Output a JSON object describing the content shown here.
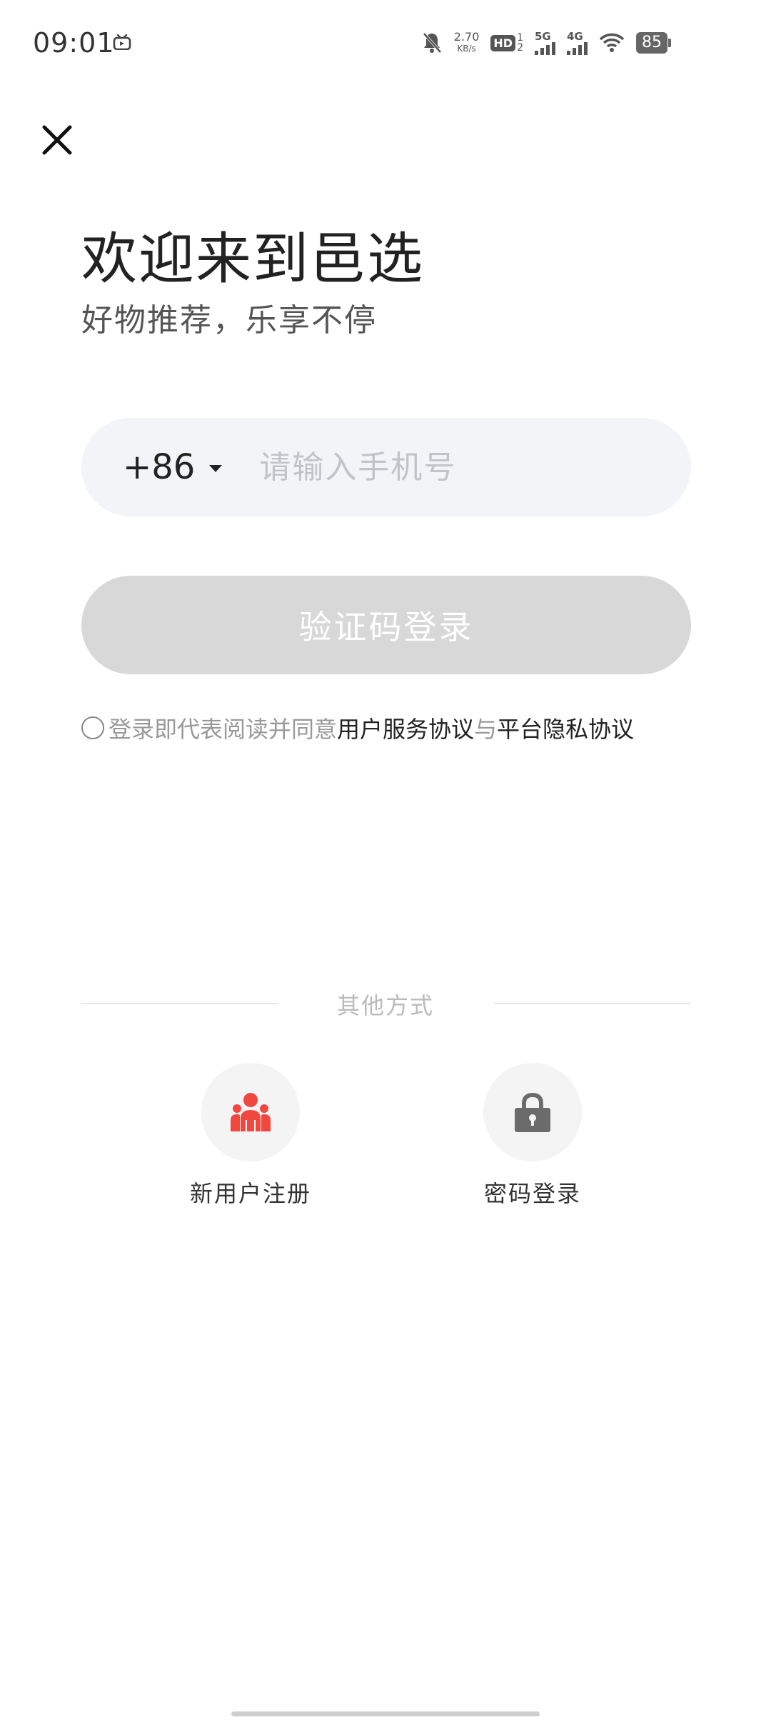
{
  "status_bar": {
    "time": "09:01",
    "net_speed_value": "2.70",
    "net_speed_unit": "KB/s",
    "hd_label": "HD",
    "sim1": "1",
    "sim2": "2",
    "signal1_label": "5G",
    "signal2_label": "4G",
    "battery": "85"
  },
  "header": {
    "title": "欢迎来到邑选",
    "subtitle": "好物推荐，乐享不停"
  },
  "phone": {
    "country_code": "+86",
    "placeholder": "请输入手机号",
    "value": ""
  },
  "login_button": {
    "label": "验证码登录"
  },
  "agreement": {
    "prefix": "登录即代表阅读并同意",
    "link1": "用户服务协议",
    "joiner": "与",
    "link2": "平台隐私协议"
  },
  "other": {
    "label": "其他方式",
    "register_label": "新用户注册",
    "password_label": "密码登录"
  },
  "colors": {
    "accent_red": "#f2473f",
    "button_disabled": "#d8d8d8",
    "input_bg": "#f3f4f8"
  }
}
